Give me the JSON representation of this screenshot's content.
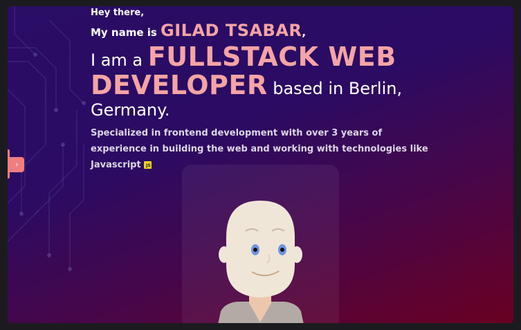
{
  "hero": {
    "greeting": "Hey there,",
    "name_prefix": "My name is ",
    "name": "GILAD TSABAR",
    "name_suffix": ",",
    "role_prefix": "I am a ",
    "role": "FULLSTACK WEB DEVELOPER",
    "location": " based in Berlin, Germany.",
    "description": "Specialized in frontend development with over 3 years of experience in building the web and working with technologies like Javascript",
    "badge": "JS"
  },
  "side_tab": {
    "label": "›"
  },
  "colors": {
    "accent": "#f4a4a4",
    "tab": "#f07e7e"
  }
}
